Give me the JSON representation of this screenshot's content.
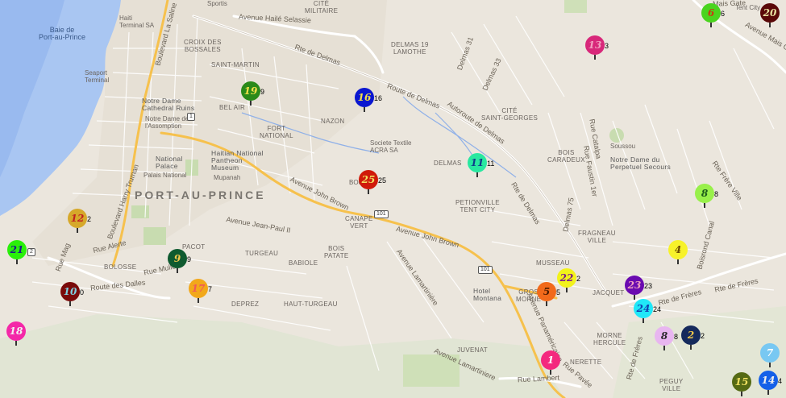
{
  "labels": [
    {
      "id": "baie",
      "text": "Baie de\nPort-au-Prince",
      "cls": "water"
    },
    {
      "id": "haiti-terminal",
      "text": "Haiti\nTerminal SA",
      "cls": "small"
    },
    {
      "id": "seaport",
      "text": "Seaport\nTerminal",
      "cls": "small"
    },
    {
      "id": "sportis",
      "text": "Sportis",
      "cls": "small"
    },
    {
      "id": "cite-militaire",
      "text": "CITÉ\nMILITAIRE"
    },
    {
      "id": "croix-bossales",
      "text": "CROIX DES\nBOSSALES"
    },
    {
      "id": "saint-martin",
      "text": "SAINT-MARTIN"
    },
    {
      "id": "delmas-lamothe",
      "text": "DELMAS 19\nLAMOTHE"
    },
    {
      "id": "notre-dame",
      "text": "Notre Dame\nCathedral Ruins",
      "cls": "poi"
    },
    {
      "id": "notre-dame-ass",
      "text": "Notre Dame de\nl'Assomption",
      "cls": "small"
    },
    {
      "id": "bel-air",
      "text": "BEL AIR"
    },
    {
      "id": "fort-national",
      "text": "FORT\nNATIONAL"
    },
    {
      "id": "nazon",
      "text": "NAZON"
    },
    {
      "id": "cite-st-georges",
      "text": "CITÉ\nSAINT-GEORGES"
    },
    {
      "id": "national-palace",
      "text": "National\nPalace",
      "cls": "poi"
    },
    {
      "id": "palais-national",
      "text": "Palais National",
      "cls": "small"
    },
    {
      "id": "pantheon",
      "text": "Haitian National\nPantheon\nMuseum",
      "cls": "poi"
    },
    {
      "id": "mupanah",
      "text": "Mupanah",
      "cls": "small"
    },
    {
      "id": "societe",
      "text": "Societe Textile\nACRA SA",
      "cls": "small"
    },
    {
      "id": "delmas-label",
      "text": "DELMAS"
    },
    {
      "id": "bois-caradeux",
      "text": "BOIS\nCARADEUX"
    },
    {
      "id": "soussou",
      "text": "Soussou",
      "cls": "small"
    },
    {
      "id": "notre-dame-perp",
      "text": "Notre Dame du\nPerpetuel Secours",
      "cls": "poi"
    },
    {
      "id": "pap",
      "text": "PORT-AU-PRINCE",
      "cls": "big"
    },
    {
      "id": "bourdon",
      "text": "BOU",
      "cls": "small"
    },
    {
      "id": "petionville",
      "text": "PETIONVILLE\nTENT CITY"
    },
    {
      "id": "canape-vert",
      "text": "CANAPE\nVERT"
    },
    {
      "id": "pacot",
      "text": "PACOT"
    },
    {
      "id": "turgeau",
      "text": "TURGEAU"
    },
    {
      "id": "babiole",
      "text": "BABIOLE"
    },
    {
      "id": "bois-patate",
      "text": "BOIS\nPATATE"
    },
    {
      "id": "bolosse",
      "text": "BOLOSSE"
    },
    {
      "id": "fragneau",
      "text": "FRAGNEAU\nVILLE"
    },
    {
      "id": "musseau",
      "text": "MUSSEAU"
    },
    {
      "id": "hotel-montana",
      "text": "Hotel\nMontana",
      "cls": "poi"
    },
    {
      "id": "gros-morne",
      "text": "GROS\nMORNE"
    },
    {
      "id": "jacquet",
      "text": "JACQUET"
    },
    {
      "id": "depreze",
      "text": "DEPREZ"
    },
    {
      "id": "haut-turgeau",
      "text": "HAUT-TURGEAU"
    },
    {
      "id": "juvenat",
      "text": "JUVENAT"
    },
    {
      "id": "morne-hercule",
      "text": "MORNE\nHERCULE"
    },
    {
      "id": "nerette",
      "text": "NERETTE"
    },
    {
      "id": "pegu-ville",
      "text": "PEGUY\nVILLE"
    },
    {
      "id": "tent-city",
      "text": "Tent City",
      "cls": "small"
    },
    {
      "id": "r-haile",
      "text": "Avenue Hailé Selassie",
      "cls": "road"
    },
    {
      "id": "r-delmas",
      "text": "Rte de Delmas",
      "cls": "road"
    },
    {
      "id": "r-route-delmas",
      "text": "Route de Delmas",
      "cls": "road"
    },
    {
      "id": "r-autoroute",
      "text": "Autoroute de Delmas",
      "cls": "road"
    },
    {
      "id": "r-delmas31",
      "text": "Delmas 31",
      "cls": "road"
    },
    {
      "id": "r-delmas33",
      "text": "Delmas 33",
      "cls": "road"
    },
    {
      "id": "r-john-brown",
      "text": "Avenue John Brown",
      "cls": "road"
    },
    {
      "id": "r-john-brown2",
      "text": "Avenue John Brown",
      "cls": "road"
    },
    {
      "id": "r-jean-paul",
      "text": "Avenue Jean-Paul II",
      "cls": "road"
    },
    {
      "id": "r-lamartiniere",
      "text": "Avenue Lamartinière",
      "cls": "road"
    },
    {
      "id": "r-lamartiniere2",
      "text": "Avenue Lamartiniere",
      "cls": "road"
    },
    {
      "id": "r-dalles",
      "text": "Route des Dalles",
      "cls": "road"
    },
    {
      "id": "r-muller",
      "text": "Rue Muller",
      "cls": "road"
    },
    {
      "id": "r-alerte",
      "text": "Rue Alerte",
      "cls": "road"
    },
    {
      "id": "r-harry",
      "text": "Boulevard Harry Truman",
      "cls": "road"
    },
    {
      "id": "r-saline",
      "text": "Boulevard La Saline",
      "cls": "road"
    },
    {
      "id": "r-panamericaine",
      "text": "Avenue Panaméricaine",
      "cls": "road"
    },
    {
      "id": "r-lambert",
      "text": "Rue Lambert",
      "cls": "road"
    },
    {
      "id": "r-pavee",
      "text": "Rue Pavée",
      "cls": "road"
    },
    {
      "id": "r-frere",
      "text": "Rte de Frères",
      "cls": "road"
    },
    {
      "id": "r-frere2",
      "text": "Rte de Frères",
      "cls": "road"
    },
    {
      "id": "r-frere3",
      "text": "Rte de Frères",
      "cls": "road"
    },
    {
      "id": "r-faustin",
      "text": "Rue Faustin 1er",
      "cls": "road"
    },
    {
      "id": "r-catalpa",
      "text": "Rue Catalpa",
      "cls": "road"
    },
    {
      "id": "r-delmas75",
      "text": "Delmas 75",
      "cls": "road"
    },
    {
      "id": "r-rte-delmas2",
      "text": "Rte de Delmas",
      "cls": "road"
    },
    {
      "id": "r-bois-moquette",
      "text": "Boisrond Canal",
      "cls": "road"
    },
    {
      "id": "r-frere-ville",
      "text": "Rte Frère Ville",
      "cls": "road"
    },
    {
      "id": "r-mais-gate",
      "text": "Avenue Mais Gate",
      "cls": "road"
    },
    {
      "id": "r-mais-gate2",
      "text": "Mais Gate",
      "cls": "road"
    },
    {
      "id": "r-rue-mag",
      "text": "Rue Mag",
      "cls": "road"
    }
  ],
  "shields": [
    {
      "id": "s1",
      "text": "1"
    },
    {
      "id": "s101a",
      "text": "101"
    },
    {
      "id": "s101b",
      "text": "101"
    },
    {
      "id": "s2",
      "text": "2"
    }
  ],
  "markers": [
    {
      "n": "1",
      "count": "",
      "color": "#f4297e",
      "fg": "#ffffff"
    },
    {
      "n": "2",
      "count": "2",
      "color": "#152a5c",
      "fg": "#f2c84b"
    },
    {
      "n": "4",
      "count": "",
      "color": "#f7f22a",
      "fg": "#6b4a00"
    },
    {
      "n": "5",
      "count": "5",
      "color": "#f26a1b",
      "fg": "#4a1a00"
    },
    {
      "n": "6",
      "count": "6",
      "color": "#4ad41e",
      "fg": "#c83a12"
    },
    {
      "n": "7",
      "count": "",
      "color": "#78c8f2",
      "fg": "#ffffff"
    },
    {
      "n": "8",
      "count": "8",
      "color": "#98f04a",
      "fg": "#1a5a1a"
    },
    {
      "n": "8",
      "count": "8",
      "color": "#e8b6f0",
      "fg": "#2a2a2a"
    },
    {
      "n": "9",
      "count": "9",
      "color": "#0f5a2f",
      "fg": "#f2c84b"
    },
    {
      "n": "10",
      "count": "0",
      "color": "#7a0a0a",
      "fg": "#7fd0e0"
    },
    {
      "n": "11",
      "count": "11",
      "color": "#28e8a0",
      "fg": "#103a8a"
    },
    {
      "n": "12",
      "count": "2",
      "color": "#d6a82a",
      "fg": "#c02020"
    },
    {
      "n": "13",
      "count": "3",
      "color": "#d8287a",
      "fg": "#f2a0c0"
    },
    {
      "n": "14",
      "count": "4",
      "color": "#1460e8",
      "fg": "#f0f0f0"
    },
    {
      "n": "15",
      "count": "",
      "color": "#556a14",
      "fg": "#f0e060"
    },
    {
      "n": "16",
      "count": "16",
      "color": "#0a16d0",
      "fg": "#f2e04a"
    },
    {
      "n": "17",
      "count": "7",
      "color": "#f2a81a",
      "fg": "#f05a5a"
    },
    {
      "n": "18",
      "count": "",
      "color": "#f428a8",
      "fg": "#f2f2f2"
    },
    {
      "n": "19",
      "count": "9",
      "color": "#2a8a1a",
      "fg": "#f2e04a"
    },
    {
      "n": "20",
      "count": "",
      "color": "#5a0808",
      "fg": "#e8e0a0"
    },
    {
      "n": "21",
      "count": "",
      "color": "#2af00a",
      "fg": "#1a1a8a"
    },
    {
      "n": "22",
      "count": "2",
      "color": "#f2f21a",
      "fg": "#7a1a8a"
    },
    {
      "n": "23",
      "count": "23",
      "color": "#6a0ab0",
      "fg": "#f0a0c0"
    },
    {
      "n": "24",
      "count": "24",
      "color": "#20e8f8",
      "fg": "#1040b0"
    },
    {
      "n": "25",
      "count": "25",
      "color": "#d01a0a",
      "fg": "#f2e060"
    }
  ]
}
